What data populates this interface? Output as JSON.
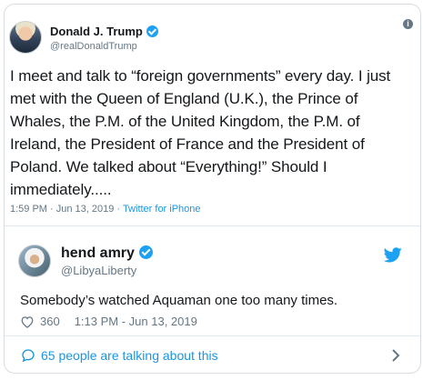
{
  "quoted_tweet": {
    "author_name": "Donald J. Trump",
    "handle": "@realDonaldTrump",
    "text": "I meet and talk to “foreign governments” every day. I just met with the Queen of England (U.K.), the Prince of Whales, the P.M. of the United Kingdom, the P.M. of Ireland, the President of France and the President of Poland. We talked about “Everything!” Should I immediately.....",
    "time": "1:59 PM · Jun 13, 2019 · ",
    "source": "Twitter for iPhone",
    "info_glyph": "i"
  },
  "reply_tweet": {
    "author_name": "hend amry",
    "handle": "@LibyaLiberty",
    "text": "Somebody’s watched Aquaman one too many times.",
    "likes": "360",
    "timestamp": "1:13 PM - Jun 13, 2019"
  },
  "conversation": {
    "label": "65 people are talking about this"
  },
  "colors": {
    "twitter_blue": "#1da1f2",
    "link_blue": "#1b95e0",
    "secondary_text": "#657786",
    "border": "#e1e8ed"
  },
  "icons": [
    "verified-badge-icon",
    "info-icon",
    "twitter-bird-icon",
    "heart-icon",
    "chat-bubble-icon",
    "chevron-right-icon"
  ]
}
